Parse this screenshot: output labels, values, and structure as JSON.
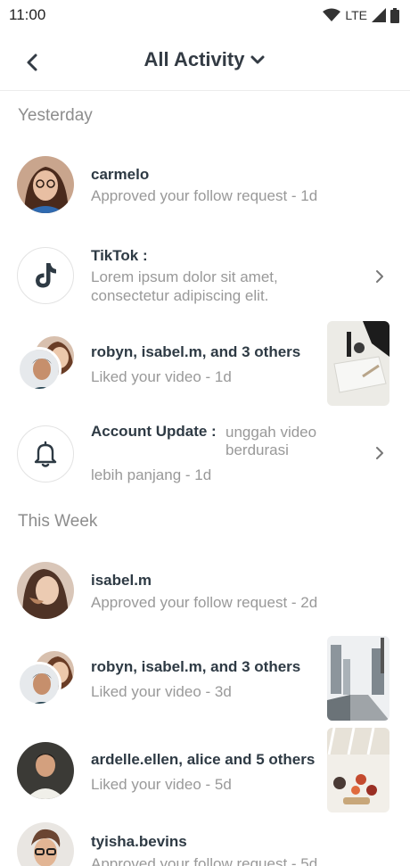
{
  "status_bar": {
    "time": "11:00",
    "network": "LTE"
  },
  "header": {
    "title": "All Activity"
  },
  "sections": {
    "yesterday": "Yesterday",
    "this_week": "This Week"
  },
  "items": [
    {
      "name": "carmelo",
      "sub": "Approved your follow request - 1d"
    },
    {
      "name": "TikTok :",
      "sub1": "Lorem ipsum dolor sit amet,",
      "sub2": "consectetur adipiscing elit."
    },
    {
      "name": "robyn, isabel.m, and 3 others",
      "sub": "Liked your video - 1d"
    },
    {
      "name": "Account Update :",
      "extra1": "unggah video",
      "extra2": "berdurasi",
      "sub": "lebih panjang - 1d"
    },
    {
      "name": "isabel.m",
      "sub": "Approved your follow request - 2d"
    },
    {
      "name": "robyn, isabel.m, and 3 others",
      "sub": "Liked your video - 3d"
    },
    {
      "name": "ardelle.ellen, alice and 5 others",
      "sub": "Liked your video - 5d"
    },
    {
      "name": "tyisha.bevins",
      "sub": "Approved your follow request - 5d"
    }
  ],
  "icons": {
    "back": "chevron-left-icon",
    "title_dropdown": "chevron-down-icon",
    "tiktok": "tiktok-logo-icon",
    "notification": "bell-icon",
    "row_open": "chevron-right-icon"
  }
}
